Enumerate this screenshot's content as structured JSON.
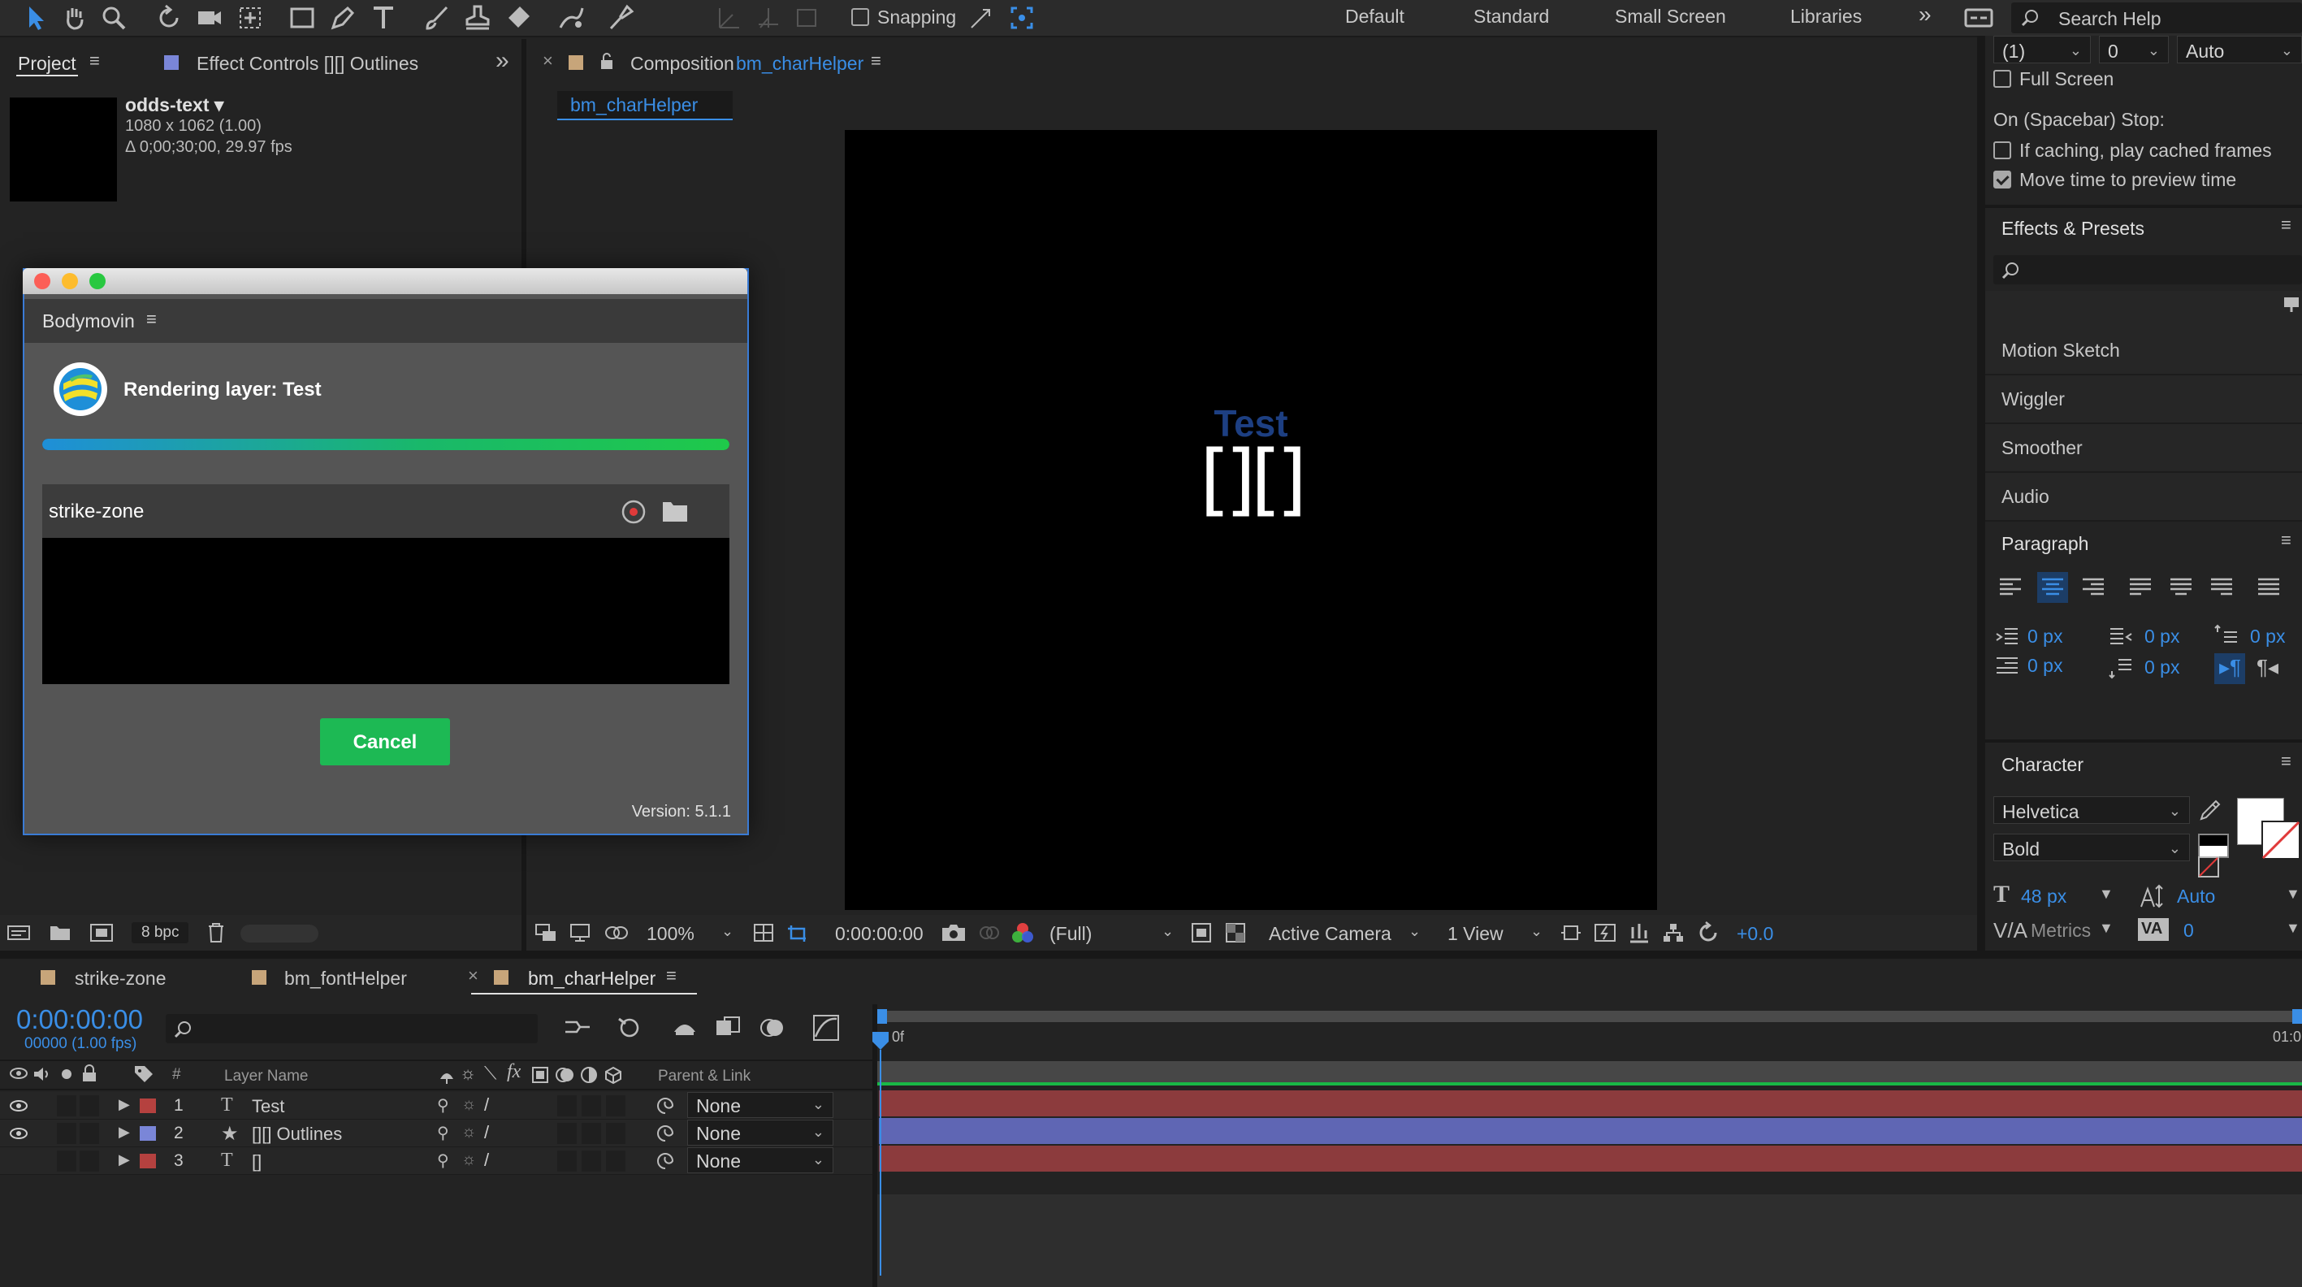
{
  "toolbar": {
    "snapping_label": "Snapping",
    "workspaces": [
      "Default",
      "Standard",
      "Small Screen",
      "Libraries"
    ],
    "search_placeholder": "Search Help"
  },
  "project_panel": {
    "tab_project": "Project",
    "tab_effect_controls": "Effect Controls [][] Outlines",
    "item_name": "odds-text ▾",
    "item_size": "1080 x 1062 (1.00)",
    "item_duration": "Δ 0;00;30;00, 29.97 fps",
    "bpc_label": "8 bpc"
  },
  "composition": {
    "tab_label": "Composition",
    "tab_name": "bm_charHelper",
    "breadcrumb": "bm_charHelper",
    "canvas_title": "Test",
    "canvas_glyphs": "[][]",
    "zoom": "100%",
    "timecode": "0:00:00:00",
    "resolution": "(Full)",
    "camera": "Active Camera",
    "views": "1 View",
    "exposure": "+0.0"
  },
  "bodymovin": {
    "title": "Bodymovin",
    "status": "Rendering layer: Test",
    "progress": 1.0,
    "comp_name": "strike-zone",
    "cancel_label": "Cancel",
    "version": "Version: 5.1.1"
  },
  "preview": {
    "frame_rate": "(1)",
    "skip": "0",
    "resolution": "Auto",
    "full_screen": "Full Screen",
    "stop_label": "On (Spacebar) Stop:",
    "opt1": "If caching, play cached frames",
    "opt2": "Move time to preview time"
  },
  "effects_presets": {
    "title": "Effects & Presets",
    "items": [
      "Motion Sketch",
      "Wiggler",
      "Smoother",
      "Audio"
    ]
  },
  "paragraph": {
    "title": "Paragraph",
    "indent_left": "0 px",
    "indent_right": "0 px",
    "indent_first": "0 px",
    "space_before": "0 px",
    "space_after": "0 px"
  },
  "character": {
    "title": "Character",
    "font": "Helvetica",
    "style": "Bold",
    "size": "48 px",
    "leading": "Auto",
    "kerning": "Metrics",
    "tracking": "0"
  },
  "timeline": {
    "tabs": [
      "strike-zone",
      "bm_fontHelper",
      "bm_charHelper"
    ],
    "timecode": "0:00:00:00",
    "frame_info": "00000 (1.00 fps)",
    "col_number": "#",
    "col_layer_name": "Layer Name",
    "col_parent": "Parent & Link",
    "ruler_start": "0f",
    "ruler_end": "01:0",
    "layers": [
      {
        "num": "1",
        "type": "T",
        "name": "Test",
        "parent": "None",
        "color": "#b5413f"
      },
      {
        "num": "2",
        "type": "★",
        "name": "[][] Outlines",
        "parent": "None",
        "color": "#7a86d8"
      },
      {
        "num": "3",
        "type": "T",
        "name": "[]",
        "parent": "None",
        "color": "#b5413f"
      }
    ]
  }
}
